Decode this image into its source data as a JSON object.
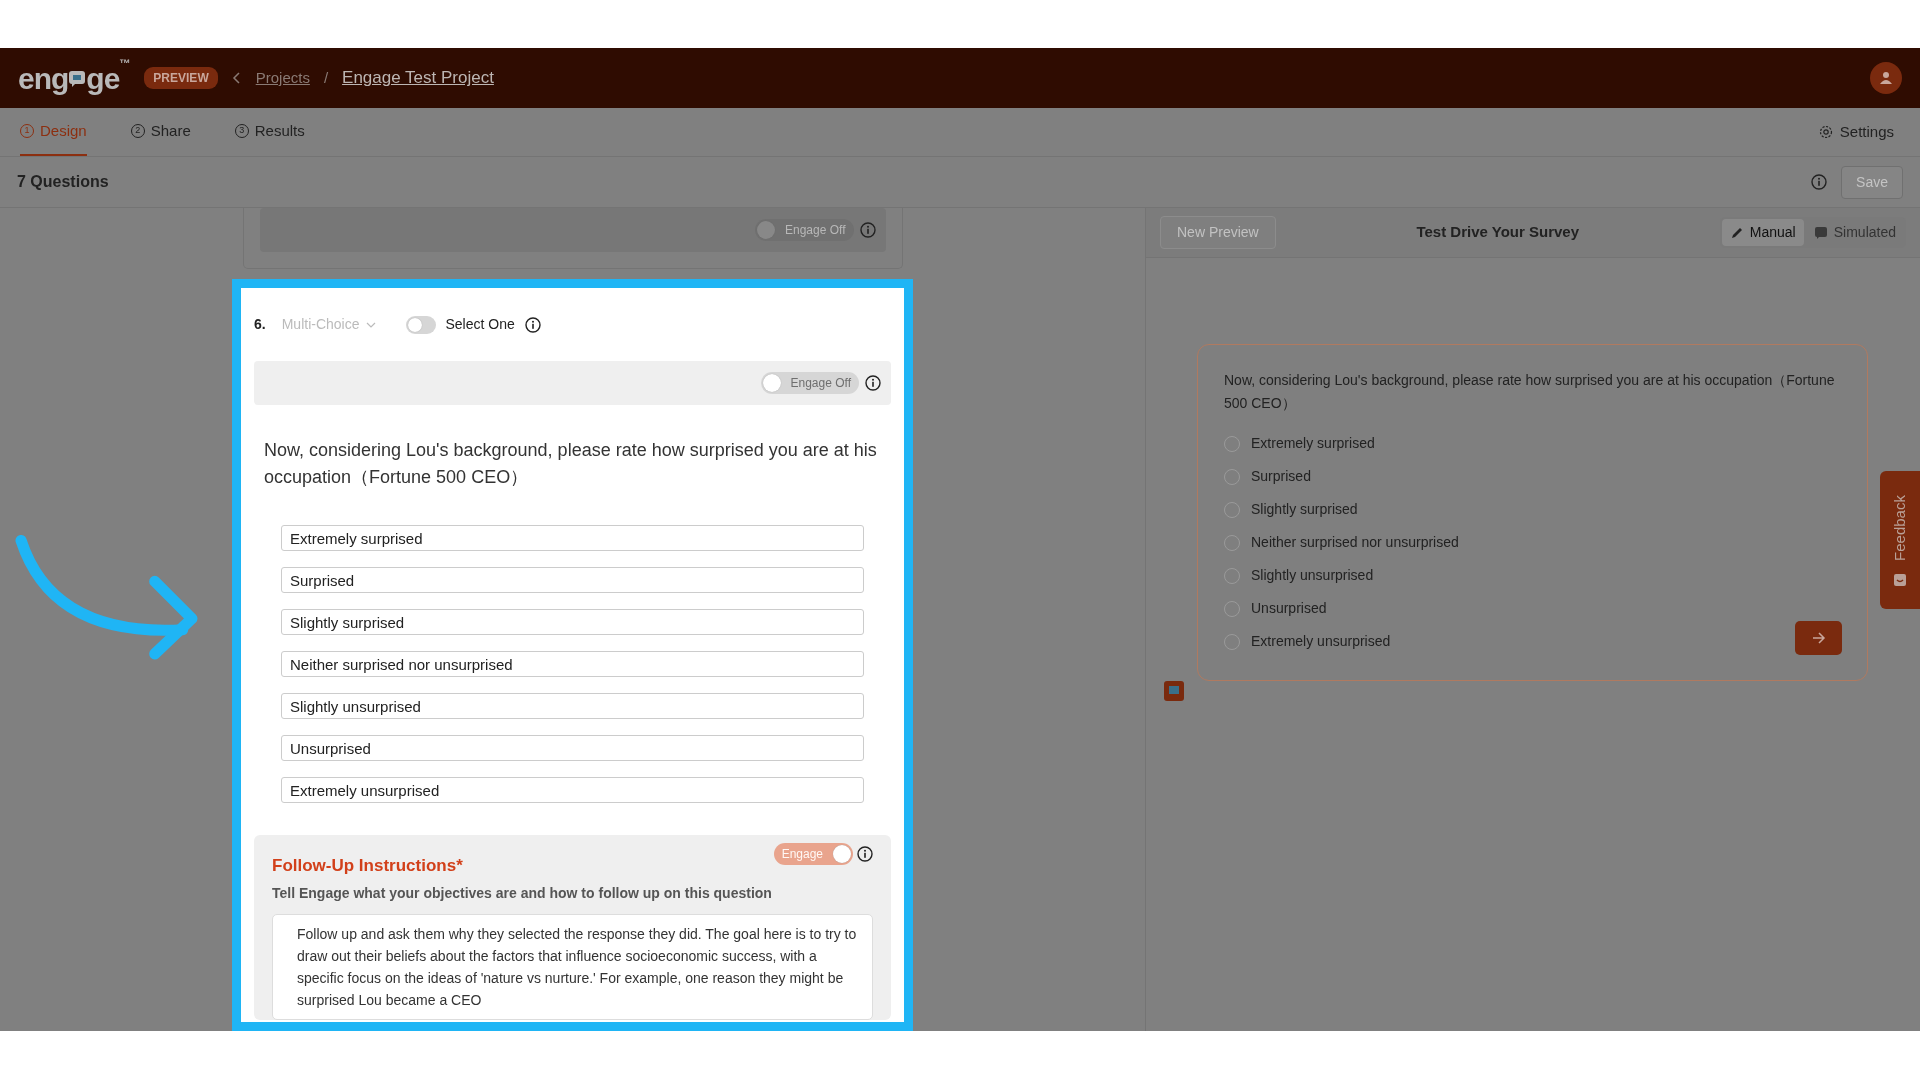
{
  "header": {
    "logo": {
      "before": "eng",
      "after": "ge",
      "mark": "™"
    },
    "badge": "PREVIEW",
    "breadcrumb": [
      "Projects",
      "Engage Test Project"
    ],
    "separator": "/"
  },
  "tabs": [
    {
      "number": "1",
      "label": "Design",
      "selected": true
    },
    {
      "number": "2",
      "label": "Share",
      "selected": false
    },
    {
      "number": "3",
      "label": "Results",
      "selected": false
    }
  ],
  "settings": "Settings",
  "toolbar": {
    "title": "7 Questions",
    "save": {
      "label": "Save",
      "disabled": true
    }
  },
  "previous_card": {
    "engage_toggle": {
      "label": "Engage Off",
      "on": false
    }
  },
  "question": {
    "number": "6.",
    "type": "Multi-Choice",
    "select_one": {
      "label": "Select One",
      "on": false
    },
    "engage_toggle": {
      "label": "Engage Off",
      "on": false
    },
    "text": "Now, considering Lou's background, please rate how surprised you are at his occupation（Fortune 500 CEO）",
    "options": [
      "Extremely surprised",
      "Surprised",
      "Slightly surprised",
      "Neither surprised nor unsurprised",
      "Slightly unsurprised",
      "Unsurprised",
      "Extremely unsurprised"
    ],
    "follow_up": {
      "title": "Follow-Up Instructions*",
      "toggle": {
        "label": "Engage",
        "on": true
      },
      "subtitle": "Tell Engage what your objectives are and how to follow up on this question",
      "text": "Follow up and ask them why they selected the response they did. The goal here is to try to draw out their beliefs about the factors that influence socioeconomic success, with a specific focus on the ideas of 'nature vs nurture.' For example, one reason they might be surprised Lou became a CEO"
    }
  },
  "preview": {
    "new_preview": {
      "label": "New Preview",
      "disabled": true
    },
    "title": "Test Drive Your Survey",
    "modes": [
      {
        "label": "Manual",
        "selected": true
      },
      {
        "label": "Simulated",
        "selected": false
      }
    ],
    "question": "Now, considering Lou's background, please rate how surprised you are at his occupation（Fortune 500 CEO）",
    "options": [
      {
        "label": "Extremely surprised",
        "selected": false
      },
      {
        "label": "Surprised",
        "selected": false
      },
      {
        "label": "Slightly surprised",
        "selected": false
      },
      {
        "label": "Neither surprised nor unsurprised",
        "selected": false
      },
      {
        "label": "Slightly unsurprised",
        "selected": false
      },
      {
        "label": "Unsurprised",
        "selected": false
      },
      {
        "label": "Extremely unsurprised",
        "selected": false
      }
    ]
  },
  "feedback": "Feedback"
}
